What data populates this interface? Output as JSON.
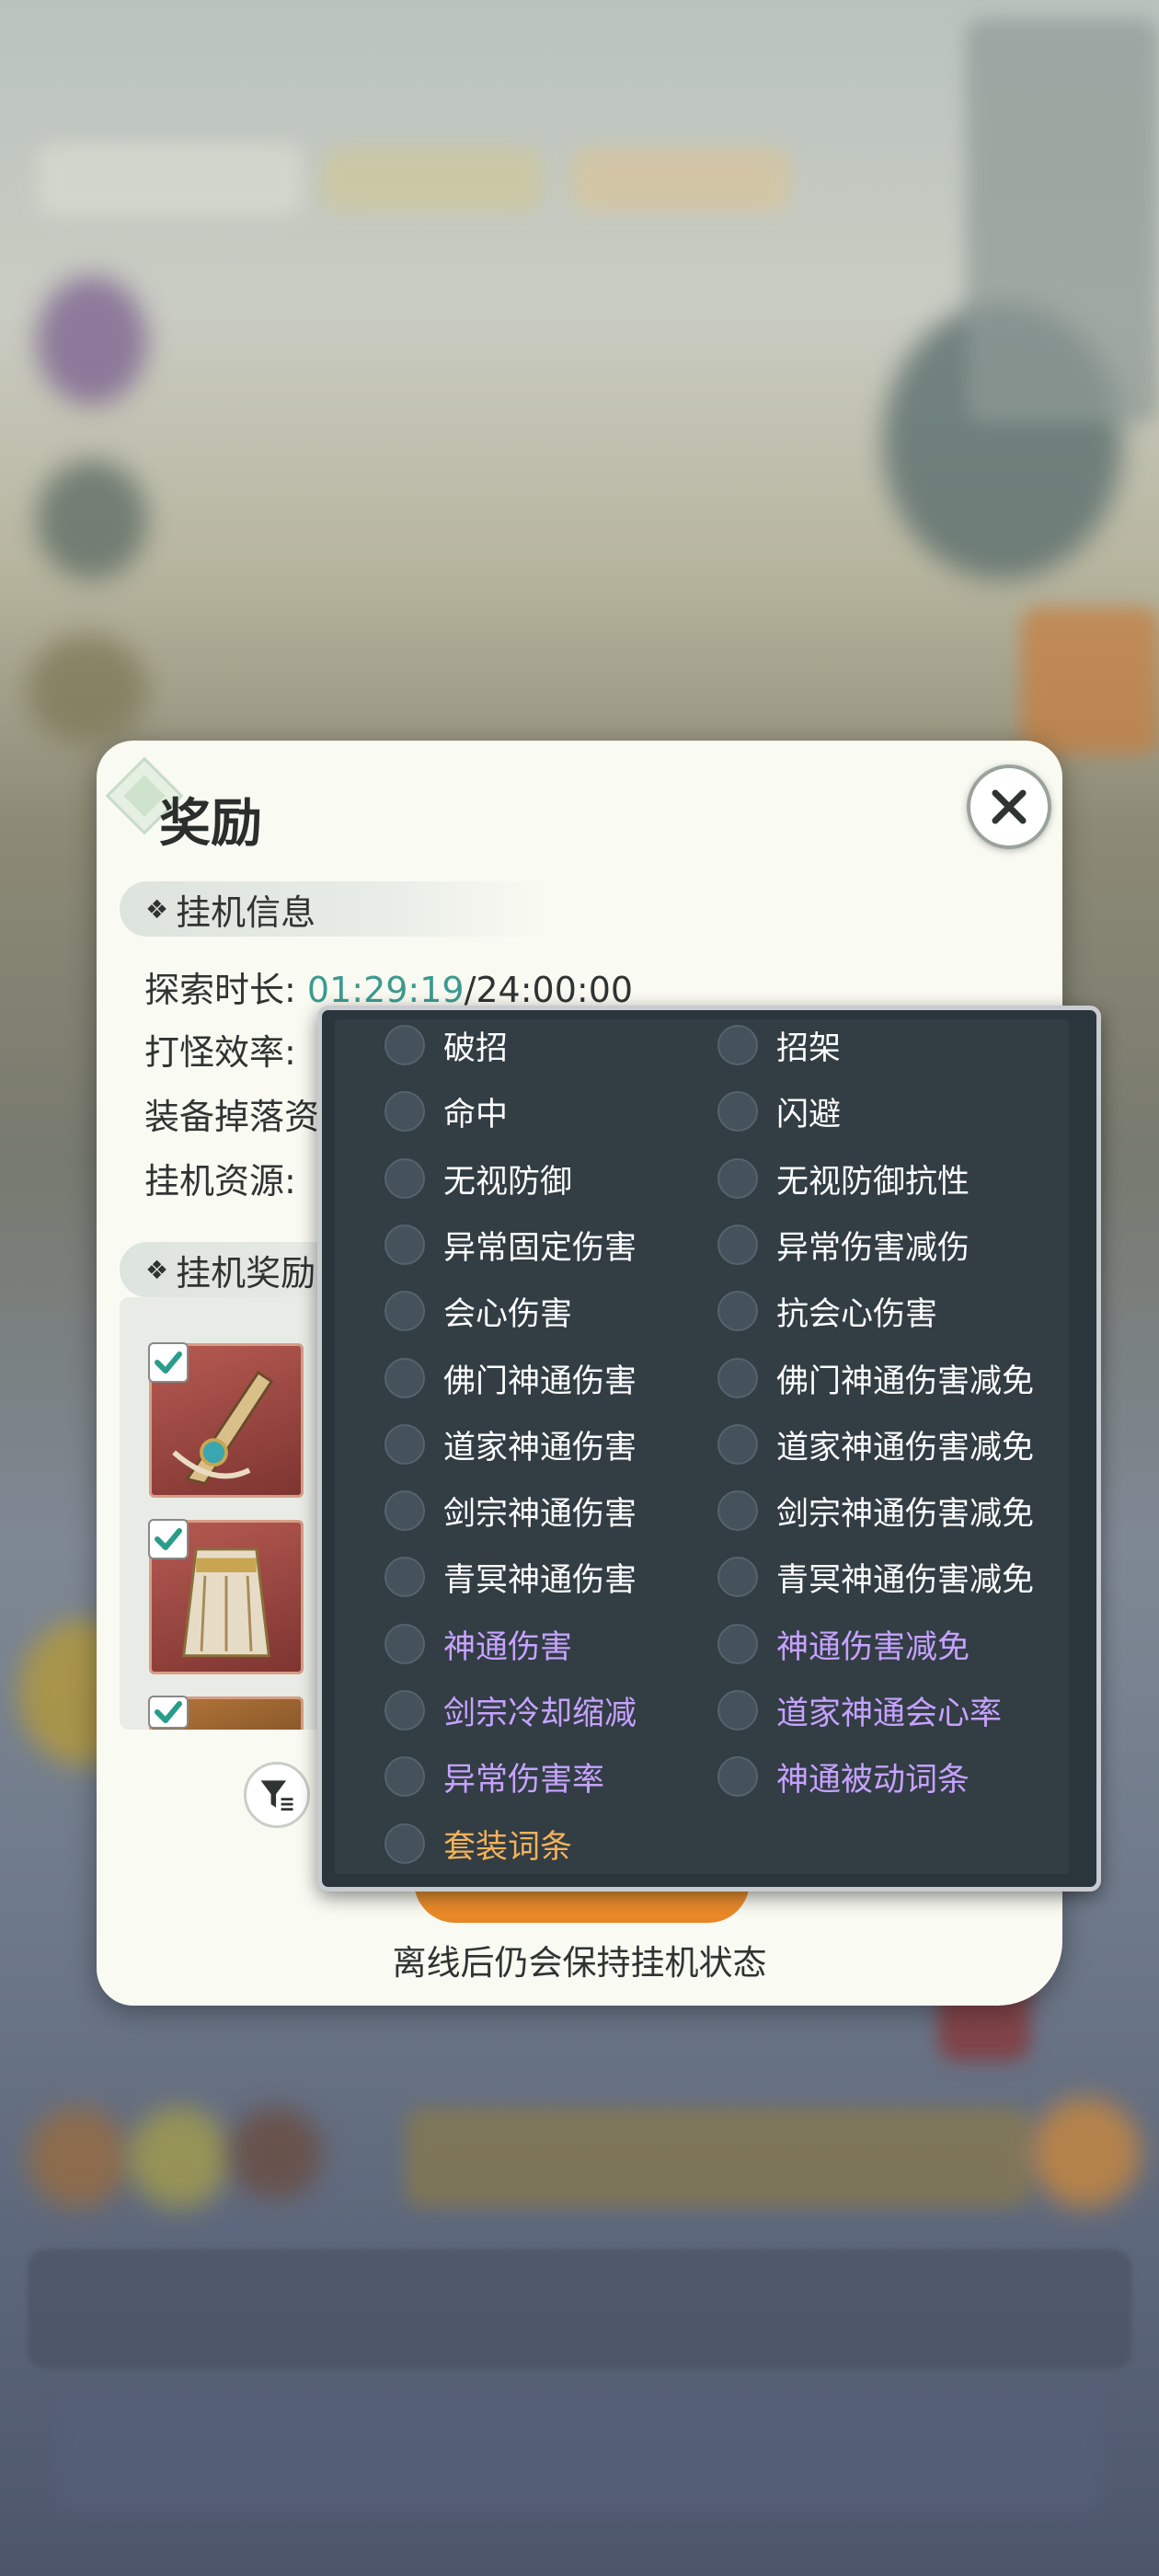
{
  "colors": {
    "time_elapsed": "#3c9a8f",
    "option_white": "#ffffff",
    "option_purple": "#c6a2ff",
    "option_gold": "#f2b25a",
    "popover_bg": "#2b353c",
    "dialog_bg": "#f9faf2"
  },
  "dialog": {
    "title": "奖励",
    "close_icon": "close-icon",
    "idle_info": {
      "header": "挂机信息",
      "explore_label": "探索时长:",
      "explore_elapsed": "01:29:19",
      "explore_max": "/24:00:00",
      "kill_rate_label": "打怪效率:",
      "drop_label": "装备掉落资",
      "resource_label": "挂机资源:"
    },
    "idle_rewards": {
      "header": "挂机奖励",
      "items": [
        {
          "name": "sword",
          "checked": true
        },
        {
          "name": "robe",
          "checked": true
        },
        {
          "name": "item",
          "checked": true
        }
      ]
    },
    "filter_icon": "filter-icon",
    "footer_note": "离线后仍会保持挂机状态"
  },
  "filter_options": {
    "left": [
      {
        "label": "破招",
        "color": "white",
        "selected": false
      },
      {
        "label": "命中",
        "color": "white",
        "selected": false
      },
      {
        "label": "无视防御",
        "color": "white",
        "selected": false
      },
      {
        "label": "异常固定伤害",
        "color": "white",
        "selected": false
      },
      {
        "label": "会心伤害",
        "color": "white",
        "selected": false
      },
      {
        "label": "佛门神通伤害",
        "color": "white",
        "selected": false
      },
      {
        "label": "道家神通伤害",
        "color": "white",
        "selected": false
      },
      {
        "label": "剑宗神通伤害",
        "color": "white",
        "selected": false
      },
      {
        "label": "青冥神通伤害",
        "color": "white",
        "selected": false
      },
      {
        "label": "神通伤害",
        "color": "purple",
        "selected": false
      },
      {
        "label": "剑宗冷却缩减",
        "color": "purple",
        "selected": false
      },
      {
        "label": "异常伤害率",
        "color": "purple",
        "selected": false
      },
      {
        "label": "套装词条",
        "color": "gold",
        "selected": false
      }
    ],
    "right": [
      {
        "label": "招架",
        "color": "white",
        "selected": false
      },
      {
        "label": "闪避",
        "color": "white",
        "selected": false
      },
      {
        "label": "无视防御抗性",
        "color": "white",
        "selected": false
      },
      {
        "label": "异常伤害减伤",
        "color": "white",
        "selected": false
      },
      {
        "label": "抗会心伤害",
        "color": "white",
        "selected": false
      },
      {
        "label": "佛门神通伤害减免",
        "color": "white",
        "selected": false
      },
      {
        "label": "道家神通伤害减免",
        "color": "white",
        "selected": false
      },
      {
        "label": "剑宗神通伤害减免",
        "color": "white",
        "selected": false
      },
      {
        "label": "青冥神通伤害减免",
        "color": "white",
        "selected": false
      },
      {
        "label": "神通伤害减免",
        "color": "purple",
        "selected": false
      },
      {
        "label": "道家神通会心率",
        "color": "purple",
        "selected": false
      },
      {
        "label": "神通被动词条",
        "color": "purple",
        "selected": false
      }
    ]
  }
}
